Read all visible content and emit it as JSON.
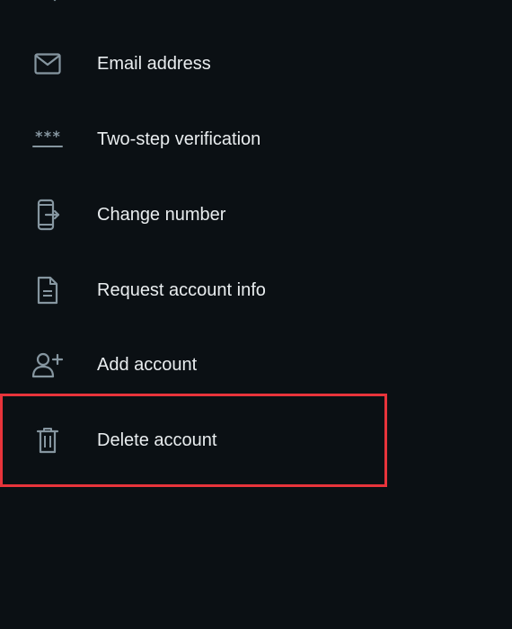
{
  "menu": {
    "items": [
      {
        "icon": "envelope-icon",
        "label": "Email address"
      },
      {
        "icon": "password-dots-icon",
        "label": "Two-step verification",
        "icon_text": "***"
      },
      {
        "icon": "phone-transfer-icon",
        "label": "Change number"
      },
      {
        "icon": "document-icon",
        "label": "Request account info"
      },
      {
        "icon": "add-person-icon",
        "label": "Add account"
      },
      {
        "icon": "trash-icon",
        "label": "Delete account"
      }
    ]
  },
  "colors": {
    "background": "#0b1014",
    "text": "#e9edef",
    "icon": "#8696a0",
    "highlight": "#e8343b"
  }
}
